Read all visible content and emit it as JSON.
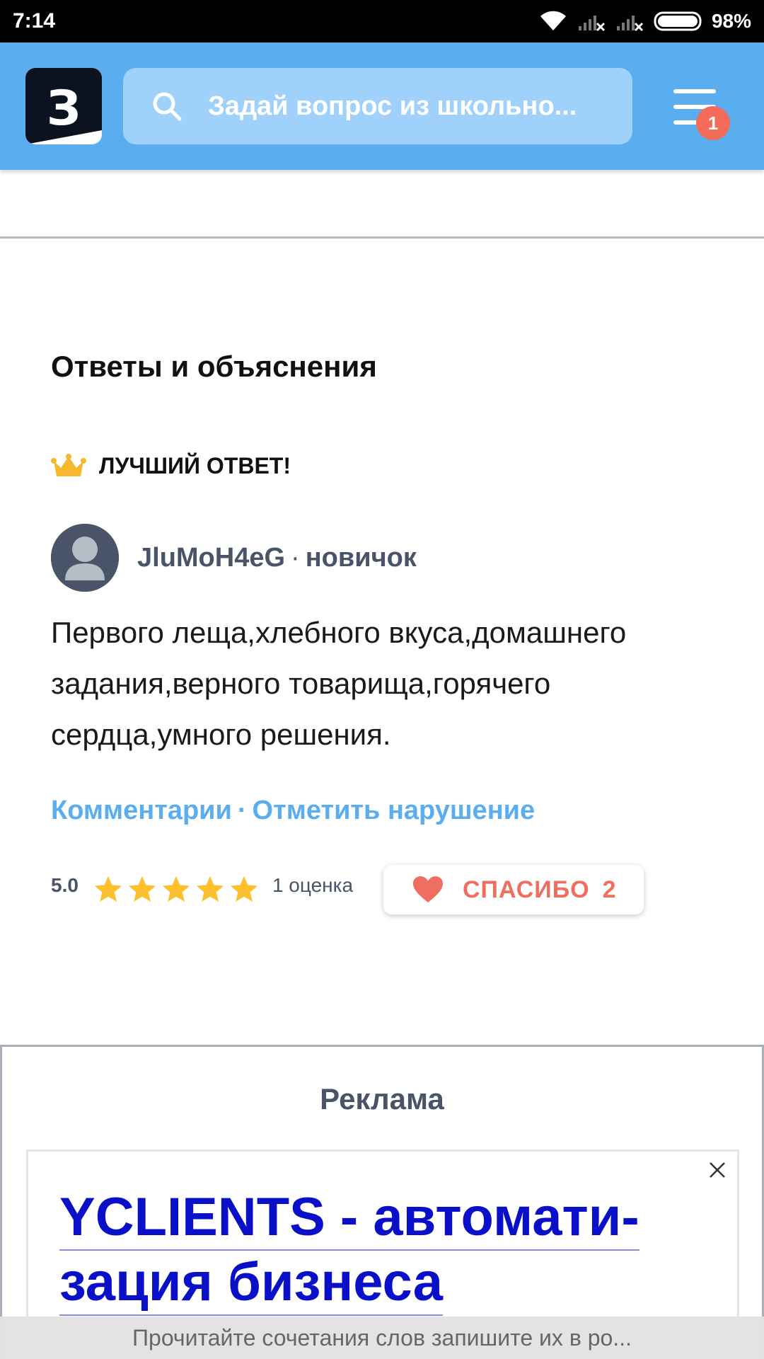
{
  "status_bar": {
    "time": "7:14",
    "battery": "98%",
    "icons": [
      "wifi-icon",
      "signal-no-service-icon",
      "signal-no-service-icon",
      "battery-icon"
    ]
  },
  "header": {
    "logo_glyph": "З",
    "search_placeholder": "Задай вопрос из школьно...",
    "notification_count": "1",
    "colors": {
      "bar": "#5aaef0",
      "search": "#9fd1fa",
      "badge": "#f26b5b"
    }
  },
  "answers": {
    "section_title": "Ответы и объяснения",
    "best_label": "ЛУЧШИЙ ОТВЕТ!",
    "author_name": "JluMoH4eG",
    "author_separator": "·",
    "author_rank": "новичок",
    "text_lines": [
      "Первого леща,хлебного вкуса,домашнего",
      "задания,верного товарища,горячего",
      "сердца,умного решения."
    ],
    "comments_link": "Комментарии",
    "link_separator": "·",
    "report_link": "Отметить нарушение",
    "rating_value": "5.0",
    "stars_filled": 5,
    "stars_total": 5,
    "rating_count": "1 оценка",
    "thanks_label": "СПАСИБО",
    "thanks_count": "2",
    "colors": {
      "link": "#5aaef0",
      "star": "#fbc02d",
      "thanks": "#ee6e5f",
      "crown": "#f5b82e"
    }
  },
  "ad": {
    "header": "Реклама",
    "title_lines": [
      "YCLIENTS - автомати-",
      "зация бизнеса"
    ],
    "title_color": "#0a10c8"
  },
  "bottom_bar": {
    "text": "Прочитайте сочетания слов запишите их в ро..."
  }
}
